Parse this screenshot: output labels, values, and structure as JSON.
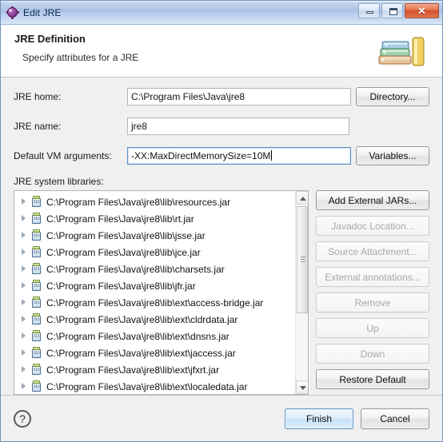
{
  "window": {
    "title": "Edit JRE",
    "app_icon": "jre-icon",
    "controls": {
      "minimize": "minimize-icon",
      "maximize": "maximize-icon",
      "close": "✕"
    }
  },
  "header": {
    "title": "JRE Definition",
    "subtitle": "Specify attributes for a JRE",
    "icon": "books-icon"
  },
  "form": {
    "jre_home": {
      "label": "JRE home:",
      "value": "C:\\Program Files\\Java\\jre8",
      "button": "Directory..."
    },
    "jre_name": {
      "label": "JRE name:",
      "value": "jre8"
    },
    "vm_args": {
      "label": "Default VM arguments:",
      "value": "-XX:MaxDirectMemorySize=10M",
      "button": "Variables...",
      "focused": true
    }
  },
  "libraries": {
    "label": "JRE system libraries:",
    "items": [
      "C:\\Program Files\\Java\\jre8\\lib\\resources.jar",
      "C:\\Program Files\\Java\\jre8\\lib\\rt.jar",
      "C:\\Program Files\\Java\\jre8\\lib\\jsse.jar",
      "C:\\Program Files\\Java\\jre8\\lib\\jce.jar",
      "C:\\Program Files\\Java\\jre8\\lib\\charsets.jar",
      "C:\\Program Files\\Java\\jre8\\lib\\jfr.jar",
      "C:\\Program Files\\Java\\jre8\\lib\\ext\\access-bridge.jar",
      "C:\\Program Files\\Java\\jre8\\lib\\ext\\cldrdata.jar",
      "C:\\Program Files\\Java\\jre8\\lib\\ext\\dnsns.jar",
      "C:\\Program Files\\Java\\jre8\\lib\\ext\\jaccess.jar",
      "C:\\Program Files\\Java\\jre8\\lib\\ext\\jfxrt.jar",
      "C:\\Program Files\\Java\\jre8\\lib\\ext\\localedata.jar"
    ],
    "jar_icon_text": "010",
    "buttons": [
      {
        "label": "Add External JARs...",
        "enabled": true
      },
      {
        "label": "Javadoc Location...",
        "enabled": false
      },
      {
        "label": "Source Attachment...",
        "enabled": false
      },
      {
        "label": "External annotations...",
        "enabled": false
      },
      {
        "label": "Remove",
        "enabled": false
      },
      {
        "label": "Up",
        "enabled": false
      },
      {
        "label": "Down",
        "enabled": false
      },
      {
        "label": "Restore Default",
        "enabled": true
      }
    ]
  },
  "footer": {
    "help": "?",
    "finish": "Finish",
    "cancel": "Cancel"
  },
  "colors": {
    "titlebar_accent": "#aabfe4",
    "close_button": "#d2512a",
    "default_button": "#c5e0f6"
  }
}
